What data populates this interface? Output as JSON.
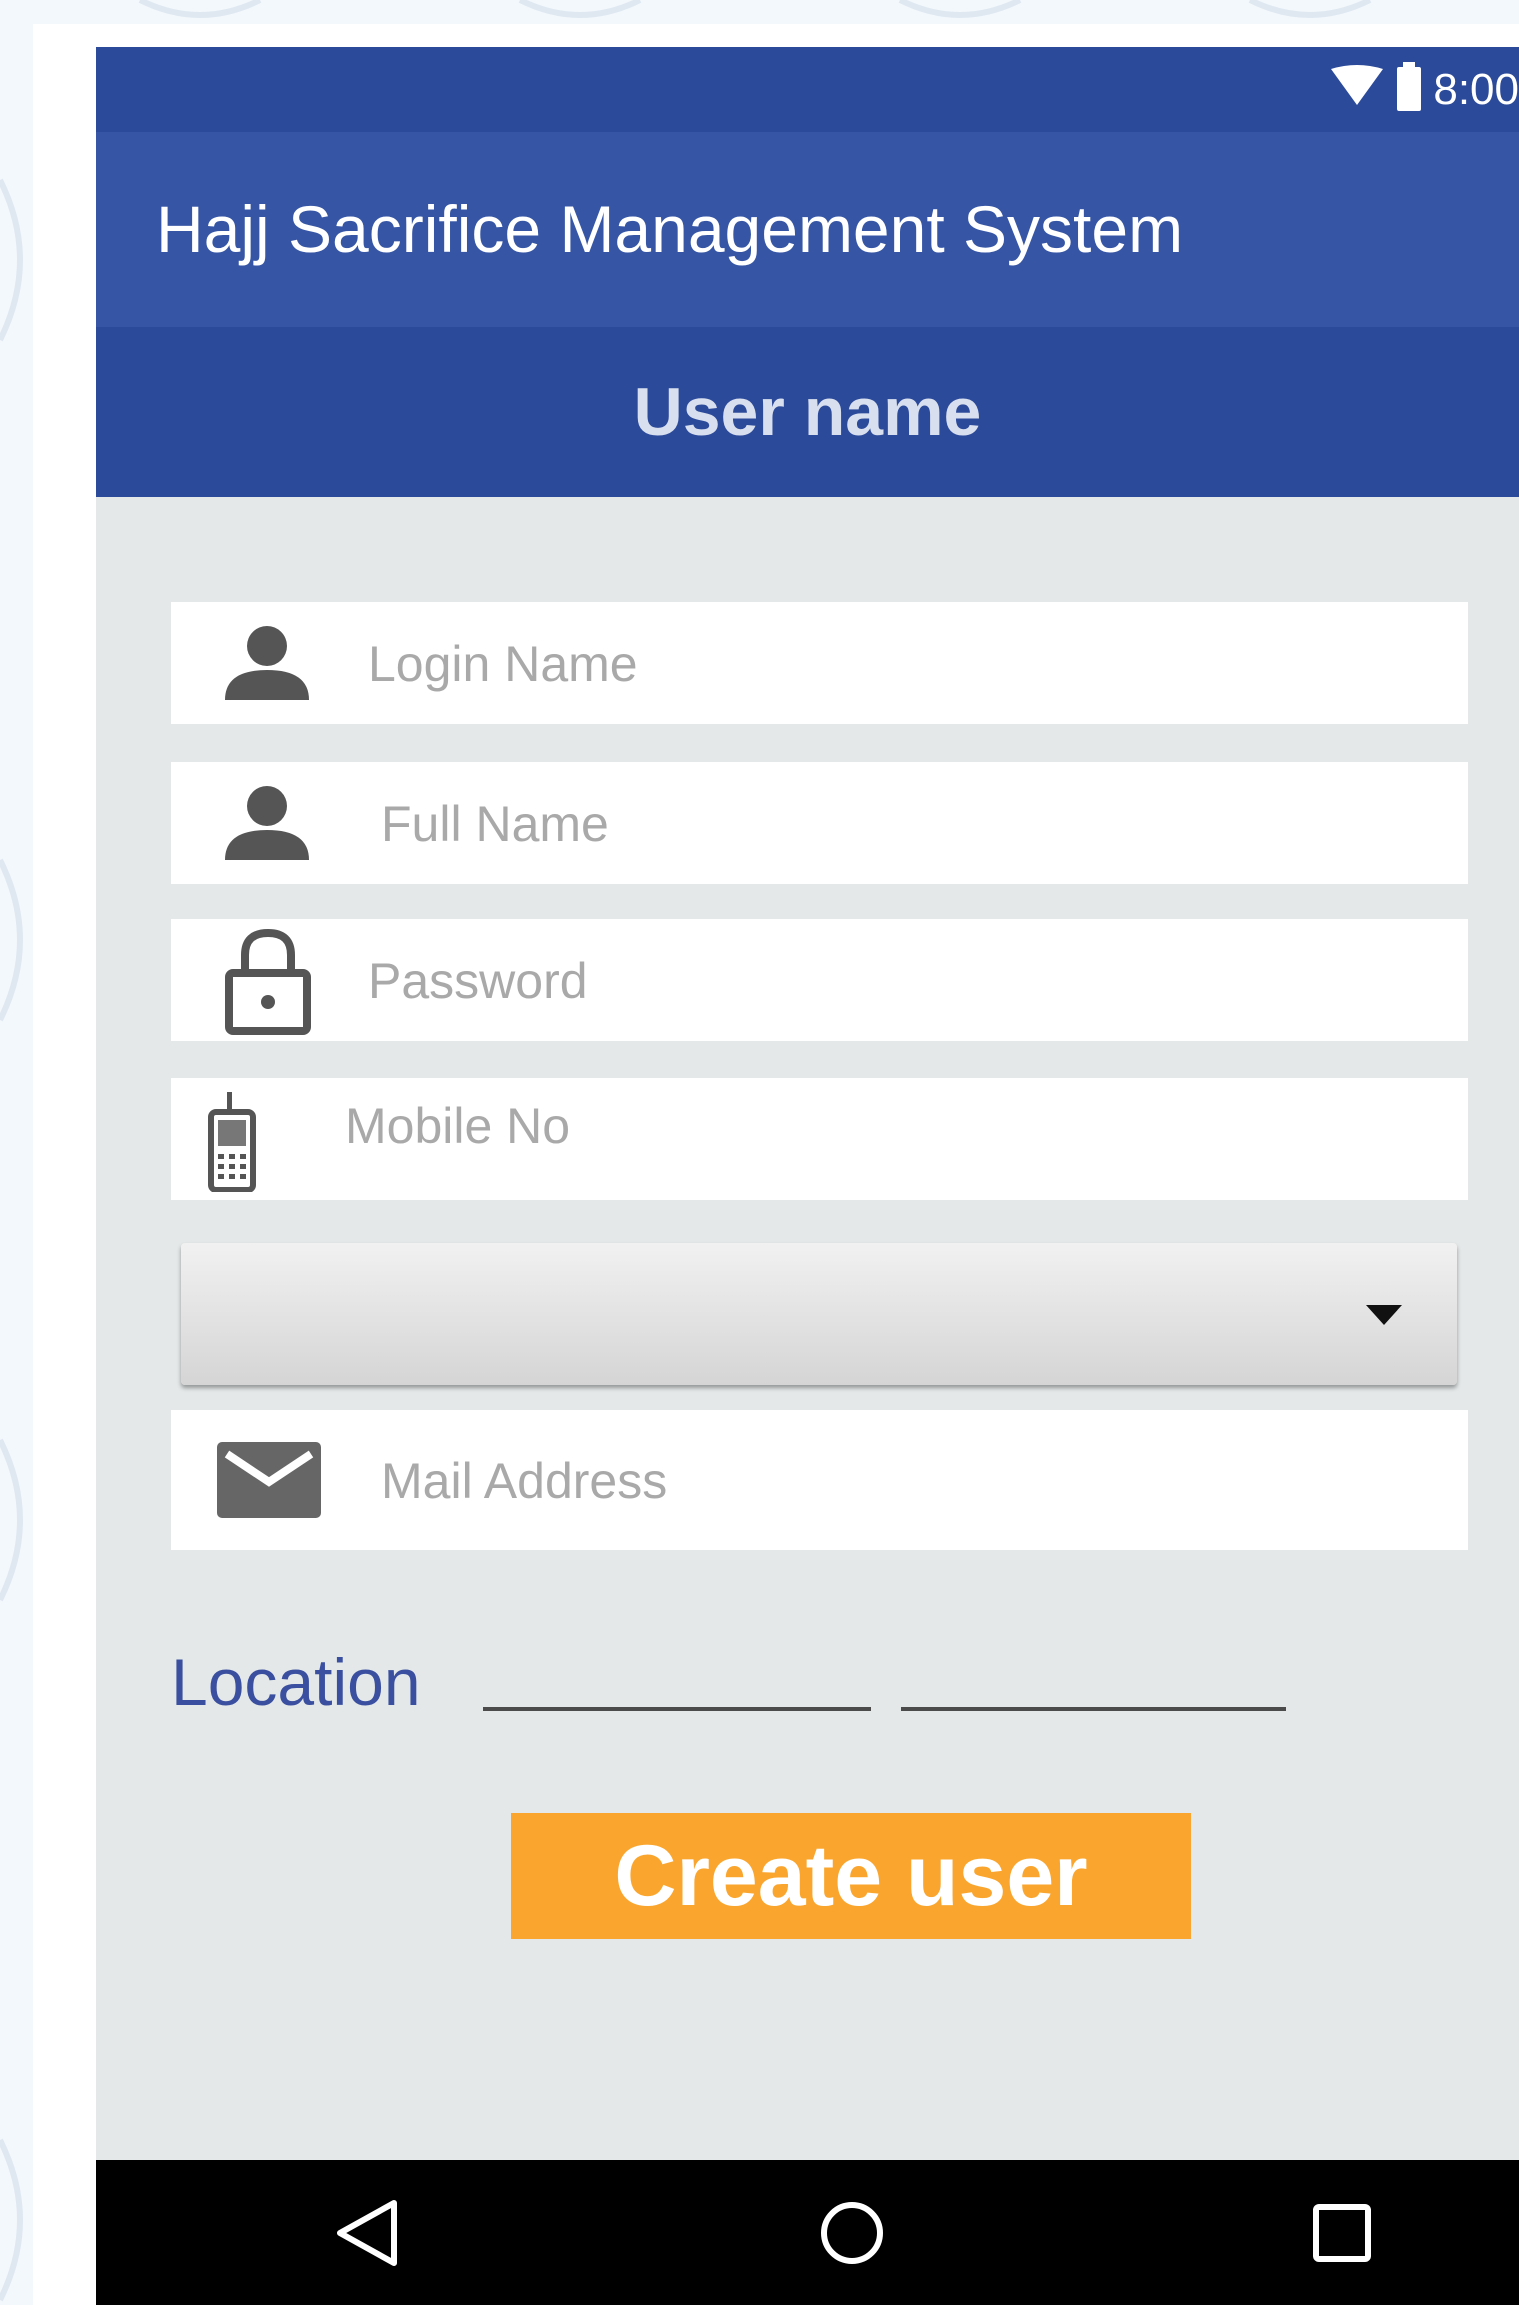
{
  "status_bar": {
    "time": "8:00",
    "icons": [
      "wifi-icon",
      "battery-icon"
    ]
  },
  "app_bar": {
    "title": "Hajj Sacrifice Management System"
  },
  "section": {
    "title": "User name"
  },
  "form": {
    "login_name": {
      "placeholder": "Login Name",
      "icon": "person-icon"
    },
    "full_name": {
      "placeholder": "Full Name",
      "icon": "person-icon"
    },
    "password": {
      "placeholder": "Password",
      "icon": "lock-icon"
    },
    "mobile_no": {
      "placeholder": "Mobile No",
      "icon": "mobile-phone-icon"
    },
    "dropdown": {
      "selected": "",
      "icon": "caret-down-icon"
    },
    "mail_address": {
      "placeholder": "Mail Address",
      "icon": "envelope-icon"
    },
    "location_label": "Location",
    "create_button": "Create user"
  },
  "nav_bar": {
    "buttons": [
      "back-icon",
      "home-icon",
      "recents-icon"
    ]
  },
  "colors": {
    "status_bar": "#2c4a9a",
    "app_bar": "#3656a5",
    "section_header": "#2c4a9a",
    "screen_bg": "#e4e8e8",
    "accent_button": "#faa62e",
    "location_text": "#3a4fa0"
  }
}
